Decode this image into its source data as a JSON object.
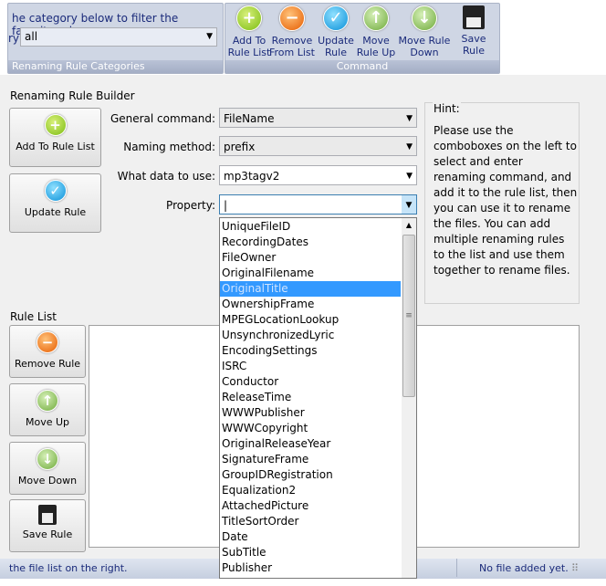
{
  "ribbon": {
    "categories": {
      "hint": "he category below to filter the favorite rules",
      "label": "ry",
      "value": "all",
      "group_label": "Renaming Rule Categories"
    },
    "command": {
      "group_label": "Command",
      "buttons": [
        {
          "label": "Add To Rule List",
          "icon": "plus-icon"
        },
        {
          "label": "Remove From List",
          "icon": "minus-icon"
        },
        {
          "label": "Update Rule",
          "icon": "check-icon"
        },
        {
          "label": "Move Rule Up",
          "icon": "arrow-up-icon"
        },
        {
          "label": "Move Rule Down",
          "icon": "arrow-down-icon"
        },
        {
          "label": "Save Rule",
          "icon": "floppy-disk-icon"
        }
      ]
    }
  },
  "builder": {
    "title": "Renaming Rule Builder",
    "add_button": "Add To Rule List",
    "update_button": "Update Rule",
    "fields": [
      {
        "label": "General command:",
        "value": "FileName"
      },
      {
        "label": "Naming method:",
        "value": "prefix"
      },
      {
        "label": "What data to use:",
        "value": "mp3tagv2"
      },
      {
        "label": "Property:",
        "value": ""
      }
    ],
    "hint_title": "Hint:",
    "hint_text": "Please use the comboboxes on the left to select and enter renaming command, and add it to the rule list, then you can use it to rename the files. You can add multiple renaming rules to the list and use them together to rename files."
  },
  "rule_list": {
    "title": "Rule List",
    "buttons": [
      "Remove Rule",
      "Move Up",
      "Move Down",
      "Save Rule"
    ]
  },
  "dropdown": {
    "selected": "OriginalTitle",
    "items": [
      "UniqueFileID",
      "RecordingDates",
      "FileOwner",
      "OriginalFilename",
      "OriginalTitle",
      "OwnershipFrame",
      "MPEGLocationLookup",
      "UnsynchronizedLyric",
      "EncodingSettings",
      "ISRC",
      "Conductor",
      "ReleaseTime",
      "WWWPublisher",
      "WWWCopyright",
      "OriginalReleaseYear",
      "SignatureFrame",
      "GroupIDRegistration",
      "Equalization2",
      "AttachedPicture",
      "TitleSortOrder",
      "Date",
      "SubTitle",
      "Publisher"
    ]
  },
  "status": {
    "left": "the file list on the right.",
    "right": "No file added yet."
  }
}
